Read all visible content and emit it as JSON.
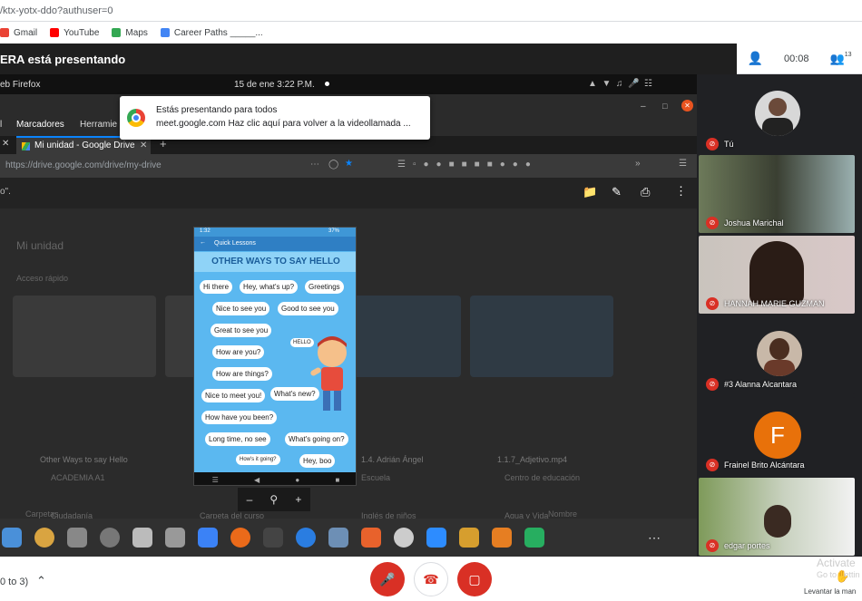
{
  "browser": {
    "url": "/ktx-yotx-ddo?authuser=0",
    "bookmarks": [
      {
        "label": "Gmail",
        "icon": "gmail-icon",
        "color": "#ea4335"
      },
      {
        "label": "YouTube",
        "icon": "youtube-icon",
        "color": "#ff0000"
      },
      {
        "label": "Maps",
        "icon": "maps-icon",
        "color": "#34a853"
      },
      {
        "label": "Career Paths _____...",
        "icon": "career-paths-icon",
        "color": "#4285f4"
      }
    ]
  },
  "meet": {
    "presenting_text": "ERA está presentando",
    "timer": "00:08",
    "participant_count": "13"
  },
  "presented": {
    "system_bar": {
      "app": "eb Firefox",
      "datetime": "15 de ene  3:22 P.M."
    },
    "firefox": {
      "menu_marcadores": "Marcadores",
      "menu_herramientas": "Herramie",
      "menu_prefix": "l",
      "tab_title": "Mi unidad - Google Drive",
      "address": "https://drive.google.com/drive/my-drive"
    },
    "share_popup": {
      "title": "Estás presentando para todos",
      "message": "meet.google.com  Haz clic aquí para volver a la videollamada ..."
    },
    "drive": {
      "left_text": "o\".",
      "heading": "Mi unidad",
      "section_recent": "Acceso rápido",
      "section_folders": "Carpetas",
      "sort_label": "Nombre",
      "files": [
        {
          "name": "Other Ways to say Hello"
        },
        {
          "name": ""
        },
        {
          "name": "1.4. Adrián Ángel"
        },
        {
          "name": "1.1.7_Adjetivo.mp4"
        }
      ],
      "folders": [
        "ACADEMIA A1",
        "Escuela",
        "Centro de educación",
        "Ciudadanía",
        "Carpeta del curso",
        "Inglés de niños",
        "Agua y Vida"
      ]
    },
    "phone": {
      "status_time": "1:32",
      "status_right": "37%",
      "app_title": "Quick Lessons",
      "banner": "OTHER WAYS TO SAY HELLO",
      "phrases": [
        "Hi there",
        "Hey, what's up?",
        "Greetings",
        "Nice to see you",
        "Good to see you",
        "Great to see you",
        "How are you?",
        "How are things?",
        "Nice to meet you!",
        "What's new?",
        "How have you been?",
        "Long time, no see",
        "What's going on?",
        "How's it going?",
        "Hey, boo"
      ],
      "hello_bubble": "HELLO"
    }
  },
  "participants": [
    {
      "name": "Tú"
    },
    {
      "name": "Joshua Marichal"
    },
    {
      "name": "HANNAH MARIE GUZMAN"
    },
    {
      "name": "#3 Alanna Alcantara"
    },
    {
      "name": "Frainel Brito Alcántara",
      "avatar_letter": "F",
      "avatar_color": "#e8710a"
    },
    {
      "name": "edgar portes"
    }
  ],
  "bottom": {
    "pagination": "0 to 3)",
    "raise_hand": "Levantar la man",
    "watermark_line1": "Activate",
    "watermark_line2": "Go to Settin"
  },
  "colors": {
    "end_call": "#d93025",
    "meet_bg": "#202124"
  }
}
